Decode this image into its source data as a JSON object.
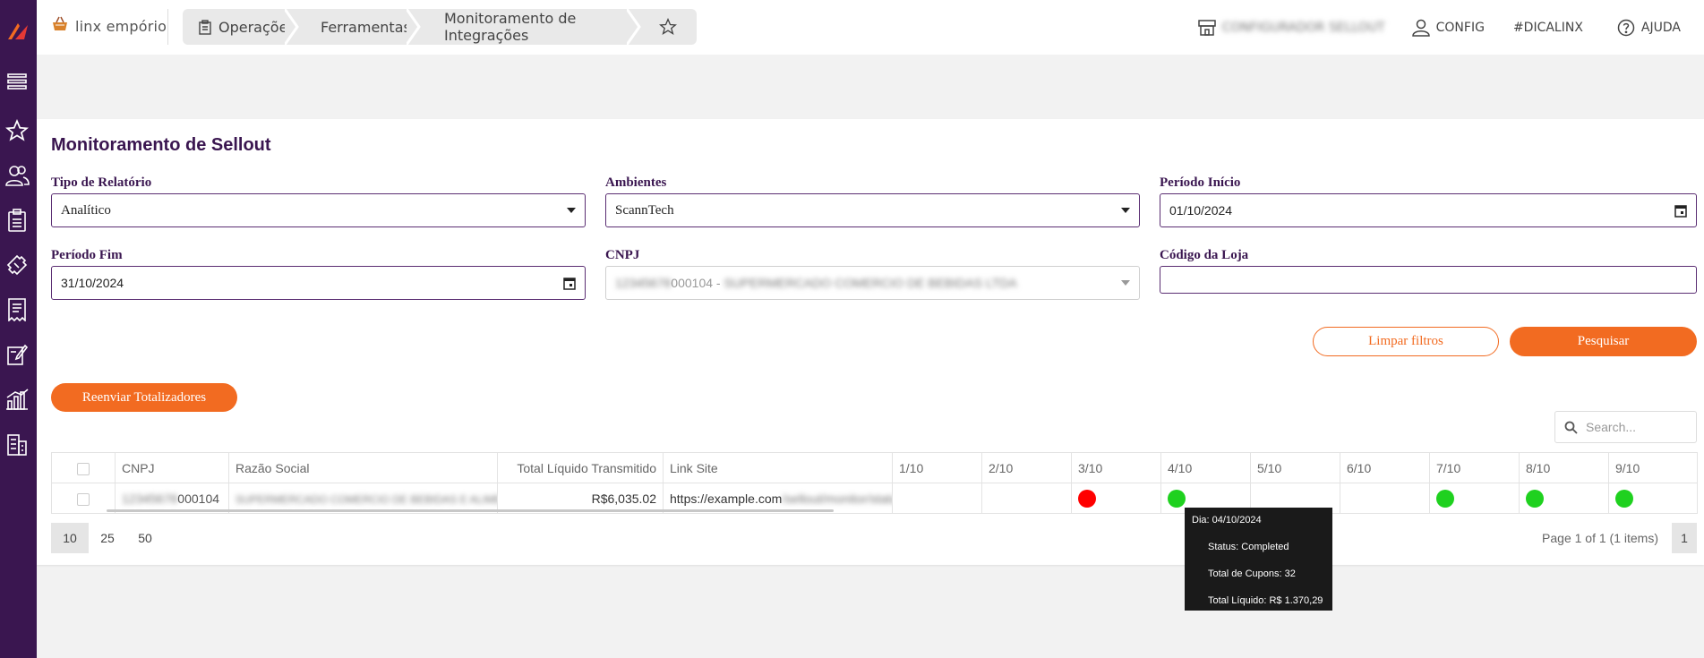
{
  "header": {
    "brand": "linx empório",
    "breadcrumbs": [
      "Operações",
      "Ferramentas",
      "Monitoramento de Integrações"
    ],
    "store_name": "CONFIGURADOR SELLOUT",
    "config_label": "CONFIG",
    "dica_label": "#DICALINX",
    "ajuda_label": "AJUDA"
  },
  "page": {
    "title": "Monitoramento de Sellout"
  },
  "filters": {
    "tipo_relatorio_label": "Tipo de Relatório",
    "tipo_relatorio_value": "Analítico",
    "ambientes_label": "Ambientes",
    "ambientes_value": "ScannTech",
    "periodo_inicio_label": "Período Início",
    "periodo_inicio_value": "01/10/2024",
    "periodo_fim_label": "Período Fim",
    "periodo_fim_value": "31/10/2024",
    "cnpj_label": "CNPJ",
    "cnpj_value_hidden": "12345678",
    "cnpj_value_visible": "000104 - ",
    "cnpj_value_hidden_tail": "SUPERMERCADO COMERCIO DE BEBIDAS LTDA",
    "codigo_loja_label": "Código da Loja",
    "codigo_loja_value": ""
  },
  "actions": {
    "limpar_label": "Limpar filtros",
    "pesquisar_label": "Pesquisar",
    "reenviar_label": "Reenviar Totalizadores",
    "search_placeholder": "Search..."
  },
  "table": {
    "columns": [
      "CNPJ",
      "Razão Social",
      "Total Líquido Transmitido",
      "Link Site",
      "1/10",
      "2/10",
      "3/10",
      "4/10",
      "5/10",
      "6/10",
      "7/10",
      "8/10",
      "9/10"
    ],
    "row": {
      "cnpj_hidden": "12345678",
      "cnpj_visible": "000104",
      "razao_social": "SUPERMERCADO COMERCIO DE BEBIDAS E ALIMENTOS LTDA",
      "total": "R$6,035.02",
      "link_visible": "https://example.com",
      "link_hidden": "/sellout/monitor/status"
    },
    "status_colors": {
      "error": "#ff0000",
      "ok": "#1fd11f"
    }
  },
  "pagination": {
    "sizes": [
      "10",
      "25",
      "50"
    ],
    "info": "Page 1 of 1 (1 items)",
    "current": "1"
  },
  "tooltip": {
    "dia": "Dia: 04/10/2024",
    "status": "Status: Completed",
    "cupons": "Total de Cupons: 32",
    "liquido": "Total Líquido: R$ 1.370,29"
  }
}
